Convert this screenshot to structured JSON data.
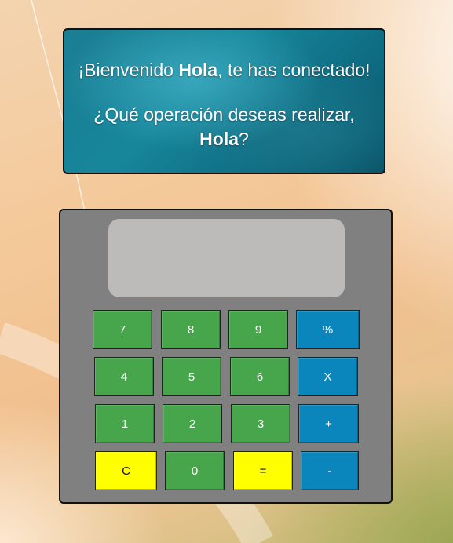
{
  "welcome": {
    "prefix": "¡Bienvenido ",
    "user": "Hola",
    "suffix": ", te has conectado!",
    "question_prefix": "¿Qué operación deseas realizar,",
    "question_user": "Hola",
    "question_suffix": "?"
  },
  "calculator": {
    "display_value": "",
    "keys": {
      "seven": "7",
      "eight": "8",
      "nine": "9",
      "percent": "%",
      "four": "4",
      "five": "5",
      "six": "6",
      "multiply": "X",
      "one": "1",
      "two": "2",
      "three": "3",
      "plus": "+",
      "clear": "C",
      "zero": "0",
      "equals": "=",
      "minus": "-"
    }
  },
  "colors": {
    "number_key": "#47a64b",
    "operator_key": "#0a86bc",
    "special_key": "#ffff00",
    "calculator_body": "#808080",
    "display": "#bdbaba"
  }
}
